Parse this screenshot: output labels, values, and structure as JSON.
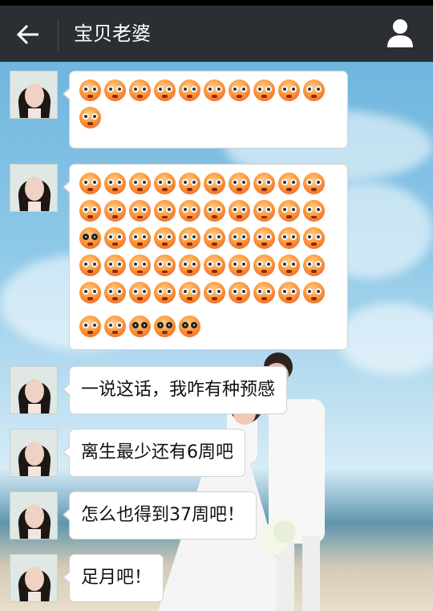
{
  "header": {
    "title": "宝贝老婆"
  },
  "messages": [
    {
      "type": "emoji",
      "emoji": "shocked-face",
      "rows": [
        10,
        1
      ]
    },
    {
      "type": "emoji",
      "emoji": "shocked-face",
      "rows": [
        10,
        10,
        10,
        10,
        10,
        5
      ]
    },
    {
      "type": "text",
      "text": "一说这话，我咋有种预感"
    },
    {
      "type": "text",
      "text": "离生最少还有6周吧"
    },
    {
      "type": "text",
      "text": "怎么也得到37周吧！"
    },
    {
      "type": "text",
      "text": "足月吧！"
    }
  ]
}
